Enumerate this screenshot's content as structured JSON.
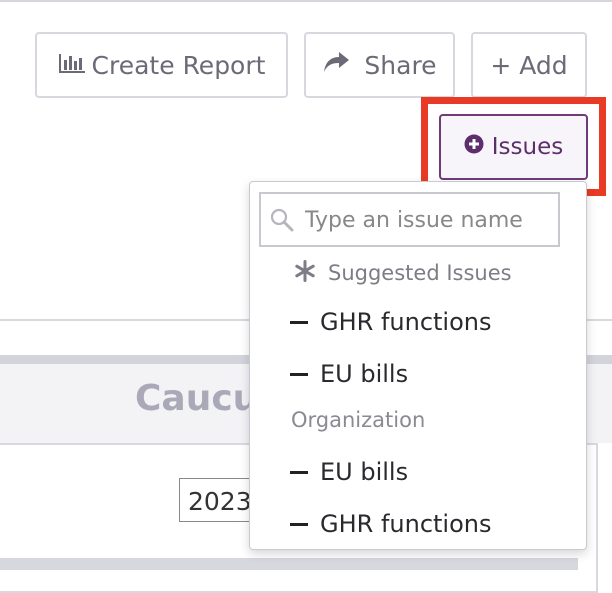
{
  "toolbar": {
    "create_report_label": "Create Report",
    "share_label": "Share",
    "add_label": "+ Add",
    "issues_label": "Issues"
  },
  "background": {
    "panel_title": "Caucus",
    "year_value": "2023"
  },
  "dropdown": {
    "search_placeholder": "Type an issue name",
    "suggested_header": "Suggested Issues",
    "suggested": [
      "GHR functions",
      "EU bills"
    ],
    "organization_header": "Organization",
    "organization": [
      "EU bills",
      "GHR functions"
    ]
  },
  "colors": {
    "highlight": "#e83a25",
    "issues_accent": "#6f3c78",
    "button_border": "#d7d7de"
  }
}
